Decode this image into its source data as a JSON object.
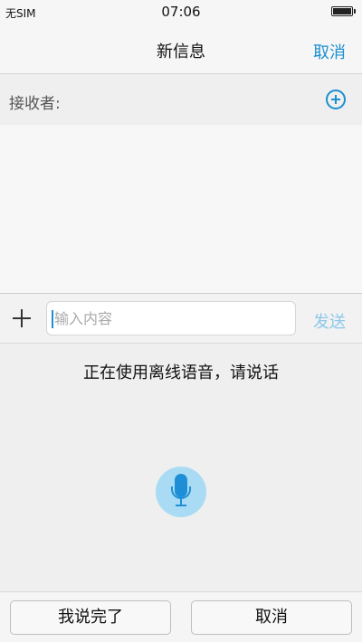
{
  "status_bar": {
    "carrier": "无SIM",
    "time": "07:06",
    "battery_icon": "battery-icon"
  },
  "header": {
    "title": "新信息",
    "cancel_label": "取消"
  },
  "recipient": {
    "label": "接收者:",
    "add_icon": "plus-circle-icon"
  },
  "compose": {
    "attach_icon": "plus-icon",
    "placeholder": "输入内容",
    "value": "",
    "send_label": "发送"
  },
  "voice": {
    "status": "正在使用离线语音，请说话",
    "mic_icon": "microphone-icon"
  },
  "footer": {
    "done_label": "我说完了",
    "cancel_label": "取消"
  },
  "colors": {
    "accent": "#1b8fd1",
    "send_disabled": "#8cc7ea",
    "mic_bg": "#a9dcf4"
  }
}
